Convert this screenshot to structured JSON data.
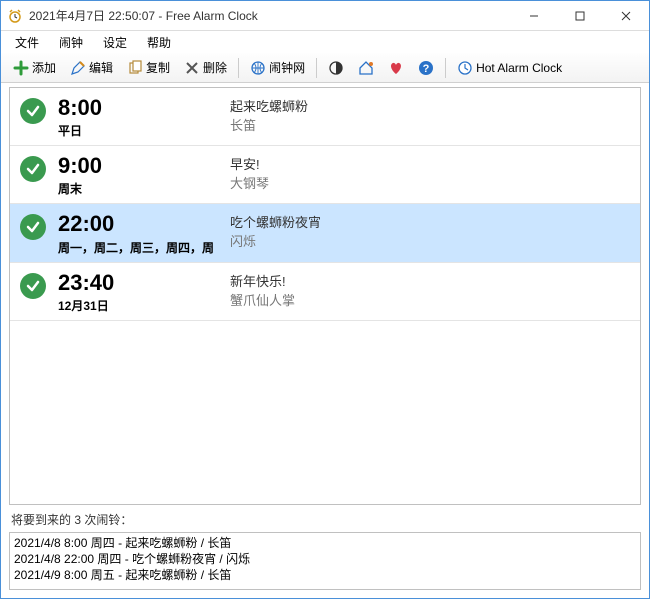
{
  "titlebar": {
    "title": "2021年4月7日 22:50:07 - Free Alarm Clock"
  },
  "menu": {
    "file": "文件",
    "alarm": "闹钟",
    "settings": "设定",
    "help": "帮助"
  },
  "toolbar": {
    "add": "添加",
    "edit": "编辑",
    "copy": "复制",
    "delete": "删除",
    "web": "闹钟网",
    "hot": "Hot Alarm Clock"
  },
  "alarms": [
    {
      "time": "8:00",
      "sched": "平日",
      "msg": "起来吃螺蛳粉",
      "sound": "长笛",
      "selected": false
    },
    {
      "time": "9:00",
      "sched": "周末",
      "msg": "早安!",
      "sound": "大钢琴",
      "selected": false
    },
    {
      "time": "22:00",
      "sched": "周一，周二，周三，周四，周",
      "msg": "吃个螺蛳粉夜宵",
      "sound": "闪烁",
      "selected": true
    },
    {
      "time": "23:40",
      "sched": "12月31日",
      "msg": "新年快乐!",
      "sound": "蟹爪仙人掌",
      "selected": false
    }
  ],
  "upcoming": {
    "label": "将要到来的 3 次闹铃：",
    "items": [
      "2021/4/8 8:00 周四 - 起来吃螺蛳粉 / 长笛",
      "2021/4/8 22:00 周四 - 吃个螺蛳粉夜宵 / 闪烁",
      "2021/4/9 8:00 周五 - 起来吃螺蛳粉 / 长笛"
    ]
  },
  "colors": {
    "selection": "#cbe5ff",
    "checkbg": "#3a9a4f"
  }
}
